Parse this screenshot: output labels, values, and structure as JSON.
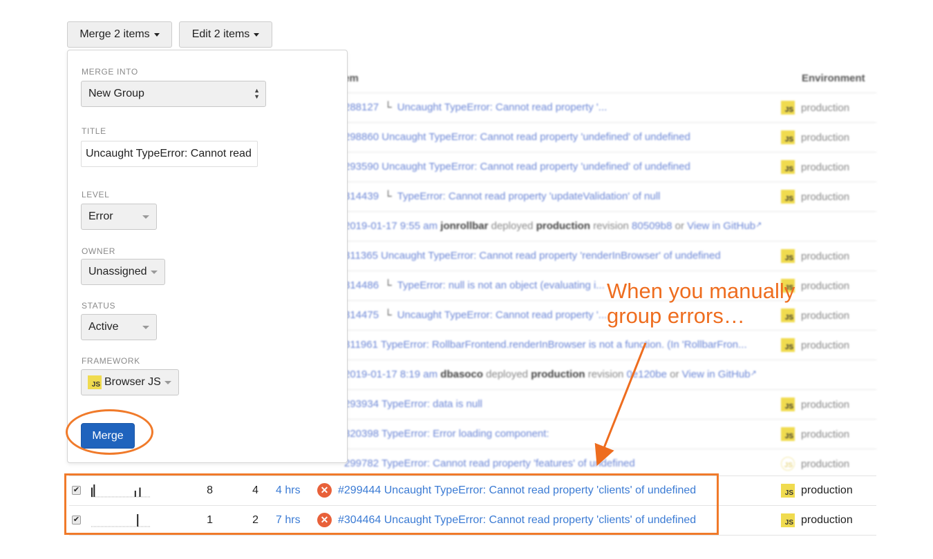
{
  "toolbar": {
    "merge_label": "Merge 2 items",
    "edit_label": "Edit 2 items"
  },
  "table": {
    "headers": {
      "item": "Item",
      "environment": "Environment"
    },
    "background_rows": [
      {
        "type": "item",
        "id": "288127",
        "forked": true,
        "title": "Uncaught TypeError: Cannot read property '...",
        "env": "production",
        "framework_icon": "js"
      },
      {
        "type": "item",
        "id": "298860",
        "forked": false,
        "title": "Uncaught TypeError: Cannot read property 'undefined' of undefined",
        "env": "production",
        "framework_icon": "js"
      },
      {
        "type": "item",
        "id": "293590",
        "forked": false,
        "title": "Uncaught TypeError: Cannot read property 'undefined' of undefined",
        "env": "production",
        "framework_icon": "js"
      },
      {
        "type": "item",
        "id": "314439",
        "forked": true,
        "title": "TypeError: Cannot read property 'updateValidation' of null",
        "env": "production",
        "framework_icon": "js"
      },
      {
        "type": "deploy",
        "time": "2019-01-17 9:55 am",
        "user": "jonrollbar",
        "verb": "deployed",
        "env": "production",
        "rev_word": "revision",
        "revision": "80509b8",
        "or": "or",
        "link": "View in GitHub"
      },
      {
        "type": "item",
        "id": "311365",
        "forked": false,
        "title": "Uncaught TypeError: Cannot read property 'renderInBrowser' of undefined",
        "env": "production",
        "framework_icon": "js"
      },
      {
        "type": "item",
        "id": "314486",
        "forked": true,
        "title": "TypeError: null is not an object (evaluating i...",
        "env": "production",
        "framework_icon": "js"
      },
      {
        "type": "item",
        "id": "314475",
        "forked": true,
        "title": "Uncaught TypeError: Cannot read property '...",
        "env": "production",
        "framework_icon": "js"
      },
      {
        "type": "item",
        "id": "311961",
        "forked": false,
        "title": "TypeError: RollbarFrontend.renderInBrowser is not a function. (In 'RollbarFron...",
        "env": "production",
        "framework_icon": "js"
      },
      {
        "type": "deploy",
        "time": "2019-01-17 8:19 am",
        "user": "dbasoco",
        "verb": "deployed",
        "env": "production",
        "rev_word": "revision",
        "revision": "0e120be",
        "or": "or",
        "link": "View in GitHub"
      },
      {
        "type": "item",
        "id": "293934",
        "forked": false,
        "title": "TypeError: data is null",
        "env": "production",
        "framework_icon": "js"
      },
      {
        "type": "item",
        "id": "320398",
        "forked": false,
        "title": "TypeError: Error loading component:",
        "env": "production",
        "framework_icon": "js"
      },
      {
        "type": "item",
        "id": "299782",
        "forked": false,
        "title": "TypeError: Cannot read property 'features' of undefined",
        "env": "production",
        "framework_icon": "other"
      }
    ],
    "selected_rows": [
      {
        "checked": true,
        "occurrences": "8",
        "users": "4",
        "last_seen": "4 hrs",
        "id": "#299444",
        "title": "Uncaught TypeError: Cannot read property 'clients' of undefined",
        "env": "production",
        "framework_icon": "js",
        "sparkline": [
          3,
          4,
          0,
          0,
          0,
          0,
          0,
          0,
          0,
          0,
          0,
          0,
          0,
          0,
          0,
          0,
          0,
          0,
          0,
          2,
          0,
          3,
          0,
          0,
          0,
          0
        ]
      },
      {
        "checked": true,
        "occurrences": "1",
        "users": "2",
        "last_seen": "7 hrs",
        "id": "#304464",
        "title": "Uncaught TypeError: Cannot read property 'clients' of undefined",
        "env": "production",
        "framework_icon": "js",
        "sparkline": [
          0,
          0,
          0,
          0,
          0,
          0,
          0,
          0,
          0,
          0,
          0,
          0,
          0,
          0,
          0,
          0,
          0,
          0,
          0,
          0,
          4,
          0,
          0,
          0,
          0,
          0
        ]
      }
    ]
  },
  "merge_panel": {
    "merge_into": {
      "label": "MERGE INTO",
      "value": "New Group"
    },
    "title": {
      "label": "TITLE",
      "value": "Uncaught TypeError: Cannot read"
    },
    "level": {
      "label": "LEVEL",
      "value": "Error"
    },
    "owner": {
      "label": "OWNER",
      "value": "Unassigned"
    },
    "status": {
      "label": "STATUS",
      "value": "Active"
    },
    "framework": {
      "label": "FRAMEWORK",
      "value": "Browser JS",
      "icon_text": "JS"
    },
    "submit_label": "Merge"
  },
  "annotation": {
    "line1": "When you manually",
    "line2": "group errors…",
    "color": "#ee6d1f"
  },
  "badges": {
    "js_text": "JS"
  },
  "colors": {
    "link": "#3b7bd4",
    "primary_button": "#1f63bd",
    "error_icon": "#e8613a",
    "js_badge": "#f0db4f",
    "highlight": "#f07a2a"
  }
}
